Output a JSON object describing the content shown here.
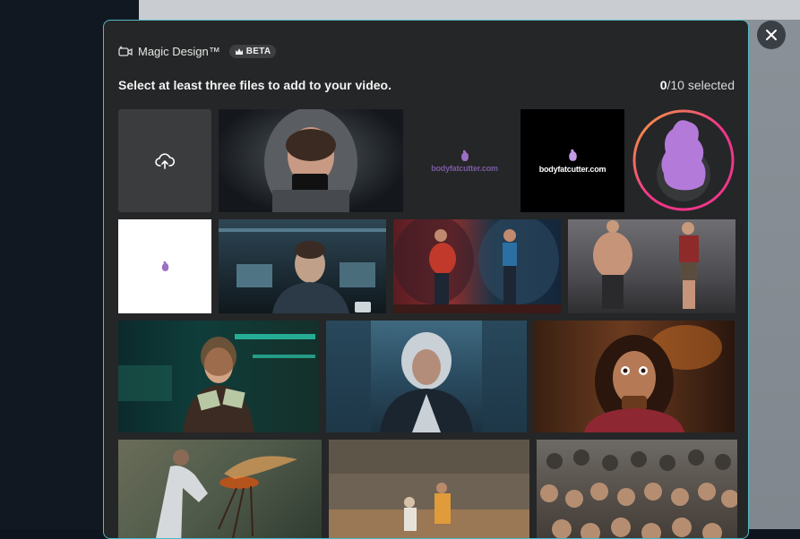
{
  "modal": {
    "title": "Magic Design™",
    "badge": "BETA",
    "instruction": "Select at least three files to add to your video.",
    "selected_count": "0",
    "selected_total": "/10 selected"
  },
  "logo_text": "bodyfatcutter.com",
  "colors": {
    "modal_border": "#4fb9c6",
    "modal_bg": "#252627",
    "brand_purple": "#b47ad9",
    "avatar_ring_start": "#f0368a",
    "avatar_ring_end": "#f6a23a"
  },
  "icons": {
    "close": "close-icon",
    "upload": "cloud-upload-icon",
    "magic": "magic-camera-icon",
    "crown": "crown-icon"
  }
}
